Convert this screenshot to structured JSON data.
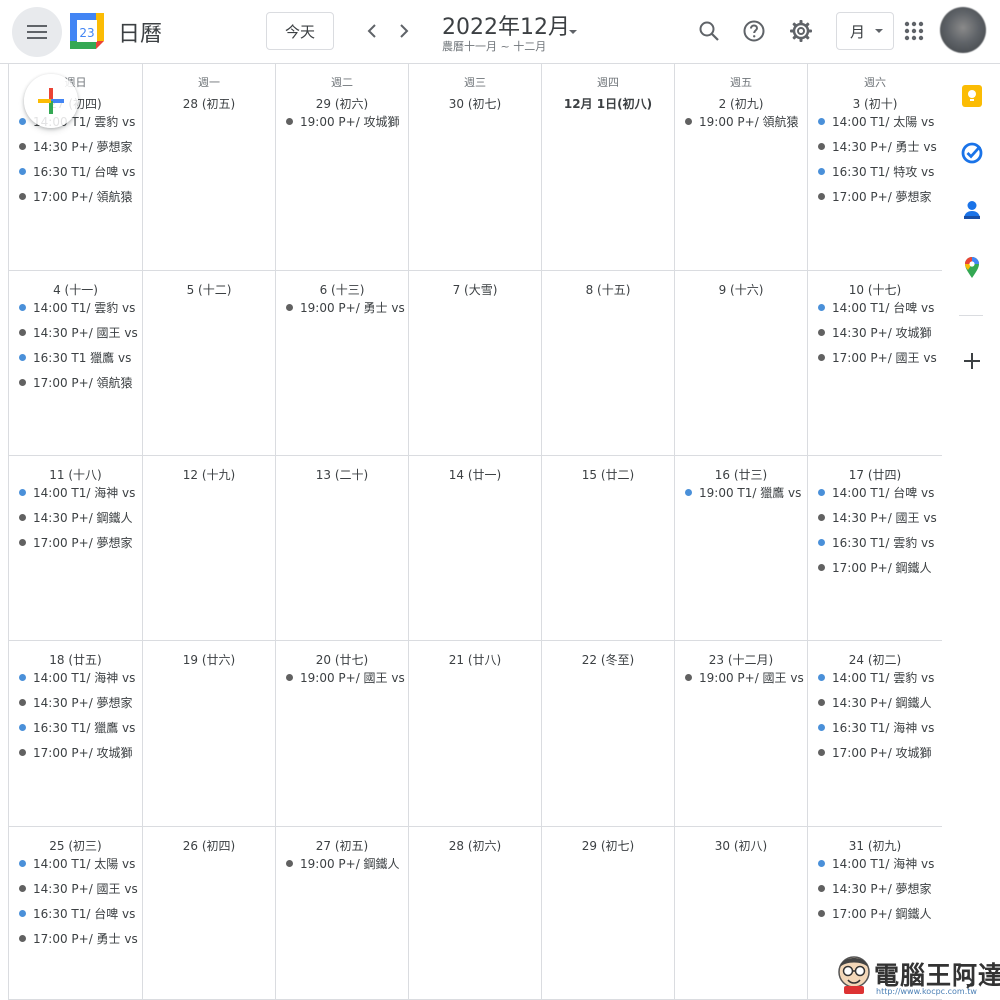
{
  "header": {
    "app_title": "日曆",
    "logo_day": "23",
    "today_label": "今天",
    "month_title": "2022年12月",
    "lunar_subtitle": "農曆十一月 ~ 十二月",
    "view_label": "月"
  },
  "colors": {
    "blue": "#4a90d9",
    "gray": "#616161"
  },
  "weekdays": [
    "週日",
    "週一",
    "週二",
    "週三",
    "週四",
    "週五",
    "週六"
  ],
  "weeks": [
    {
      "days": [
        {
          "label": "27 (初四)",
          "events": [
            {
              "text": "14:00 T1/ 雲豹 vs",
              "color": "blue"
            },
            {
              "text": "14:30 P+/ 夢想家",
              "color": "gray"
            },
            {
              "text": "16:30 T1/ 台啤 vs",
              "color": "blue"
            },
            {
              "text": "17:00 P+/ 領航猿",
              "color": "gray"
            }
          ]
        },
        {
          "label": "28 (初五)",
          "events": []
        },
        {
          "label": "29 (初六)",
          "events": [
            {
              "text": "19:00 P+/ 攻城獅",
              "color": "gray"
            }
          ]
        },
        {
          "label": "30 (初七)",
          "events": []
        },
        {
          "label": "12月 1日(初八)",
          "bold": true,
          "events": []
        },
        {
          "label": "2 (初九)",
          "events": [
            {
              "text": "19:00 P+/ 領航猿",
              "color": "gray"
            }
          ]
        },
        {
          "label": "3 (初十)",
          "events": [
            {
              "text": "14:00 T1/ 太陽 vs",
              "color": "blue"
            },
            {
              "text": "14:30 P+/ 勇士 vs",
              "color": "gray"
            },
            {
              "text": "16:30 T1/ 特攻 vs",
              "color": "blue"
            },
            {
              "text": "17:00 P+/ 夢想家",
              "color": "gray"
            }
          ]
        }
      ]
    },
    {
      "days": [
        {
          "label": "4 (十一)",
          "events": [
            {
              "text": "14:00 T1/ 雲豹 vs",
              "color": "blue"
            },
            {
              "text": "14:30 P+/ 國王 vs",
              "color": "gray"
            },
            {
              "text": "16:30 T1 獵鷹 vs",
              "color": "blue"
            },
            {
              "text": "17:00 P+/ 領航猿",
              "color": "gray"
            }
          ]
        },
        {
          "label": "5 (十二)",
          "events": []
        },
        {
          "label": "6 (十三)",
          "events": [
            {
              "text": "19:00 P+/ 勇士 vs",
              "color": "gray"
            }
          ]
        },
        {
          "label": "7 (大雪)",
          "events": []
        },
        {
          "label": "8 (十五)",
          "events": []
        },
        {
          "label": "9 (十六)",
          "events": []
        },
        {
          "label": "10 (十七)",
          "events": [
            {
              "text": "14:00 T1/ 台啤 vs",
              "color": "blue"
            },
            {
              "text": "14:30 P+/ 攻城獅",
              "color": "gray"
            },
            {
              "text": "17:00 P+/ 國王 vs",
              "color": "gray"
            }
          ]
        }
      ]
    },
    {
      "days": [
        {
          "label": "11 (十八)",
          "events": [
            {
              "text": "14:00 T1/ 海神 vs",
              "color": "blue"
            },
            {
              "text": "14:30 P+/ 鋼鐵人",
              "color": "gray"
            },
            {
              "text": "17:00 P+/ 夢想家",
              "color": "gray"
            }
          ]
        },
        {
          "label": "12 (十九)",
          "events": []
        },
        {
          "label": "13 (二十)",
          "events": []
        },
        {
          "label": "14 (廿一)",
          "events": []
        },
        {
          "label": "15 (廿二)",
          "events": []
        },
        {
          "label": "16 (廿三)",
          "events": [
            {
              "text": "19:00 T1/ 獵鷹 vs",
              "color": "blue"
            }
          ]
        },
        {
          "label": "17 (廿四)",
          "events": [
            {
              "text": "14:00 T1/ 台啤 vs",
              "color": "blue"
            },
            {
              "text": "14:30 P+/ 國王 vs",
              "color": "gray"
            },
            {
              "text": "16:30 T1/ 雲豹 vs",
              "color": "blue"
            },
            {
              "text": "17:00 P+/ 鋼鐵人",
              "color": "gray"
            }
          ]
        }
      ]
    },
    {
      "days": [
        {
          "label": "18 (廿五)",
          "events": [
            {
              "text": "14:00 T1/ 海神 vs",
              "color": "blue"
            },
            {
              "text": "14:30 P+/ 夢想家",
              "color": "gray"
            },
            {
              "text": "16:30 T1/ 獵鷹 vs",
              "color": "blue"
            },
            {
              "text": "17:00 P+/ 攻城獅",
              "color": "gray"
            }
          ]
        },
        {
          "label": "19 (廿六)",
          "events": []
        },
        {
          "label": "20 (廿七)",
          "events": [
            {
              "text": "19:00 P+/ 國王 vs",
              "color": "gray"
            }
          ]
        },
        {
          "label": "21 (廿八)",
          "events": []
        },
        {
          "label": "22 (冬至)",
          "events": []
        },
        {
          "label": "23 (十二月)",
          "events": [
            {
              "text": "19:00 P+/ 國王 vs",
              "color": "gray"
            }
          ]
        },
        {
          "label": "24 (初二)",
          "events": [
            {
              "text": "14:00 T1/ 雲豹 vs",
              "color": "blue"
            },
            {
              "text": "14:30 P+/ 鋼鐵人",
              "color": "gray"
            },
            {
              "text": "16:30 T1/ 海神 vs",
              "color": "blue"
            },
            {
              "text": "17:00 P+/ 攻城獅",
              "color": "gray"
            }
          ]
        }
      ]
    },
    {
      "days": [
        {
          "label": "25 (初三)",
          "events": [
            {
              "text": "14:00 T1/ 太陽 vs",
              "color": "blue"
            },
            {
              "text": "14:30 P+/ 國王 vs",
              "color": "gray"
            },
            {
              "text": "16:30 T1/ 台啤 vs",
              "color": "blue"
            },
            {
              "text": "17:00 P+/ 勇士 vs",
              "color": "gray"
            }
          ]
        },
        {
          "label": "26 (初四)",
          "events": []
        },
        {
          "label": "27 (初五)",
          "events": [
            {
              "text": "19:00 P+/ 鋼鐵人",
              "color": "gray"
            }
          ]
        },
        {
          "label": "28 (初六)",
          "events": []
        },
        {
          "label": "29 (初七)",
          "events": []
        },
        {
          "label": "30 (初八)",
          "events": []
        },
        {
          "label": "31 (初九)",
          "events": [
            {
              "text": "14:00 T1/ 海神 vs",
              "color": "blue"
            },
            {
              "text": "14:30 P+/ 夢想家",
              "color": "gray"
            },
            {
              "text": "17:00 P+/ 鋼鐵人",
              "color": "gray"
            }
          ]
        }
      ]
    }
  ],
  "side_panel": {
    "icons": [
      "keep-icon",
      "tasks-icon",
      "contacts-icon",
      "maps-icon"
    ]
  },
  "watermark": {
    "title": "電腦王阿達",
    "url": "http://www.kocpc.com.tw"
  }
}
